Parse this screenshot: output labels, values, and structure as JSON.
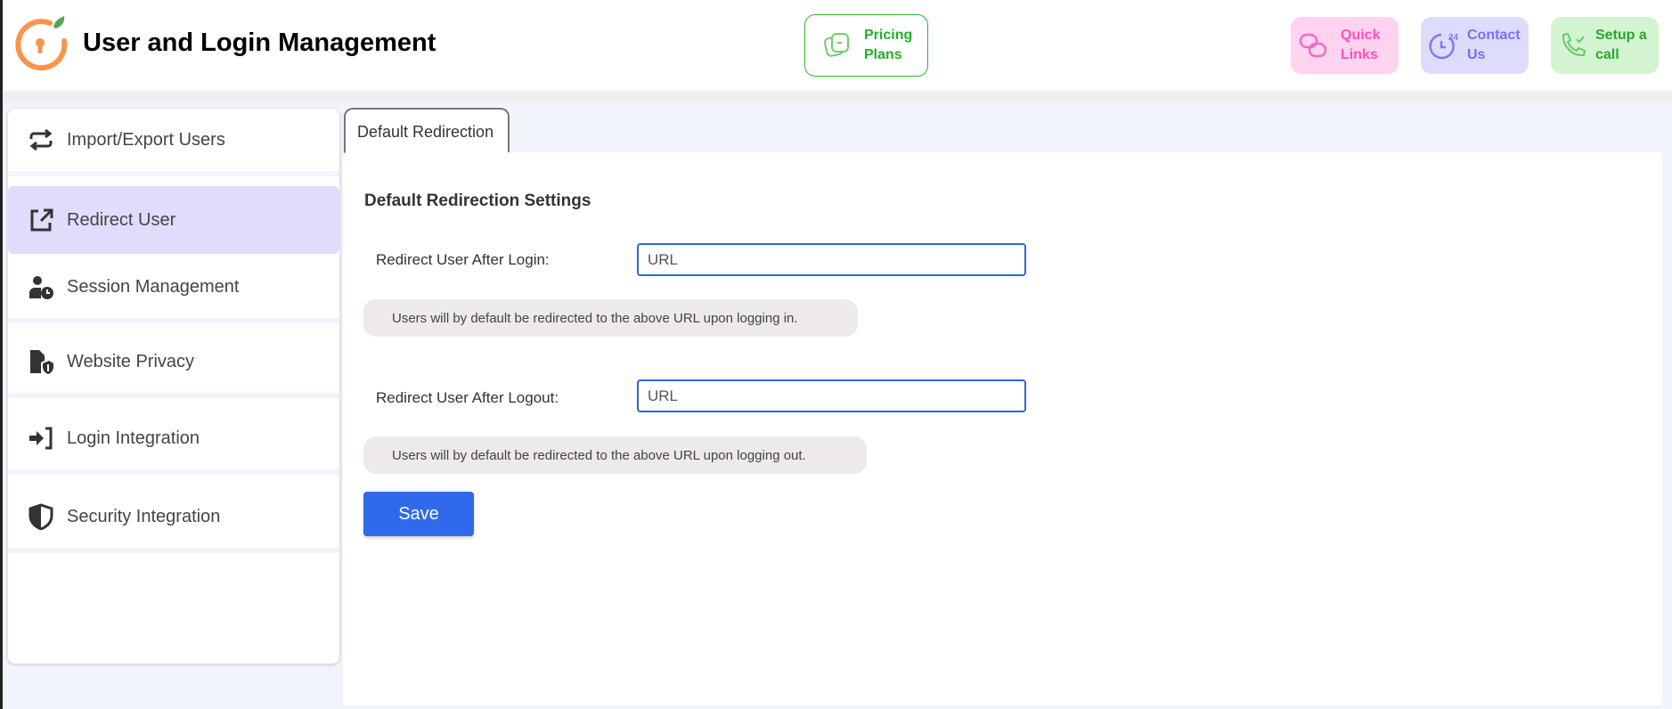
{
  "header": {
    "title": "User and Login Management",
    "pricing": "Pricing Plans",
    "quick_links": "Quick Links",
    "contact_us": "Contact Us",
    "contact_badge": "24",
    "setup_call": "Setup a call"
  },
  "sidebar": {
    "items": [
      {
        "label": "Import/Export Users",
        "icon": "import-export-icon"
      },
      {
        "label": "Redirect User",
        "icon": "external-link-icon",
        "active": true
      },
      {
        "label": "Session Management",
        "icon": "user-clock-icon"
      },
      {
        "label": "Website Privacy",
        "icon": "file-shield-icon"
      },
      {
        "label": "Login Integration",
        "icon": "sign-in-icon"
      },
      {
        "label": "Security Integration",
        "icon": "shield-icon"
      }
    ]
  },
  "tabs": [
    {
      "label": "Default Redirection",
      "active": true
    }
  ],
  "form": {
    "heading": "Default Redirection Settings",
    "login_label": "Redirect User After Login:",
    "login_placeholder": "URL",
    "login_value": "",
    "login_note": "Users will by default be redirected to the above URL upon logging in.",
    "logout_label": "Redirect User After Logout:",
    "logout_placeholder": "URL",
    "logout_value": "",
    "logout_note": "Users will by default be redirected to the above URL upon logging out.",
    "save": "Save"
  },
  "colors": {
    "accent": "#2f6aec",
    "active_item": "#e0dcfc",
    "pricing": "#22b02a",
    "quick": "#ff4fbf",
    "contact": "#7a6cff",
    "setup": "#2aa82a"
  }
}
